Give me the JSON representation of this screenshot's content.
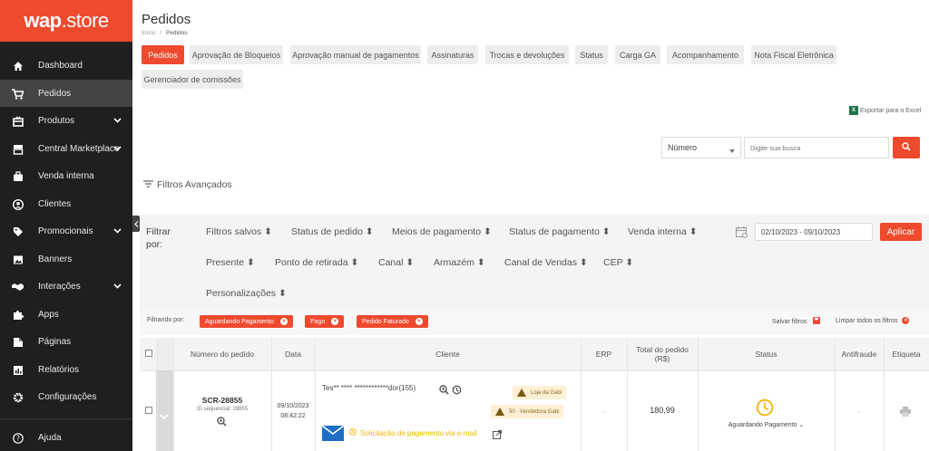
{
  "brand": {
    "name_bold": "wap",
    "name_rest": ".store"
  },
  "sidebar": {
    "items": [
      {
        "label": "Dashboard",
        "icon": "home-icon"
      },
      {
        "label": "Pedidos",
        "icon": "cart-icon"
      },
      {
        "label": "Produtos",
        "icon": "box-icon"
      },
      {
        "label": "Central Marketplace",
        "icon": "store-icon"
      },
      {
        "label": "Venda interna",
        "icon": "briefcase-icon"
      },
      {
        "label": "Clientes",
        "icon": "user-icon"
      },
      {
        "label": "Promocionais",
        "icon": "tag-icon"
      },
      {
        "label": "Banners",
        "icon": "image-icon"
      },
      {
        "label": "Interações",
        "icon": "handshake-icon"
      },
      {
        "label": "Apps",
        "icon": "puzzle-icon"
      },
      {
        "label": "Páginas",
        "icon": "file-icon"
      },
      {
        "label": "Relatórios",
        "icon": "chart-icon"
      },
      {
        "label": "Configurações",
        "icon": "gear-icon"
      }
    ],
    "help_label": "Ajuda"
  },
  "page": {
    "title": "Pedidos",
    "breadcrumb_home": "Início",
    "breadcrumb_sep": "/",
    "breadcrumb_current": "Pedidos"
  },
  "tabs": [
    "Pedidos",
    "Aprovação de Bloqueios",
    "Aprovação manual de pagamentos",
    "Assinaturas",
    "Trocas e devoluções",
    "Status",
    "Carga GA",
    "Acompanhamento",
    "Nota Fiscal Eletrônica",
    "Gerenciador de comissões"
  ],
  "export_label": "Exportar para o Excel",
  "search": {
    "type_value": "Número",
    "placeholder": "Digite sua busca"
  },
  "advanced_filters_label": "Filtros Avançados",
  "filters": {
    "filter_by": "Filtrar por:",
    "items": [
      "Filtros salvos",
      "Status de pedido",
      "Meios de pagamento",
      "Status de pagamento",
      "Venda interna",
      "Presente",
      "Ponto de retirada",
      "Canal",
      "Armazém",
      "Canal de Vendas",
      "CEP",
      "Personalizações"
    ],
    "date_range": "02/10/2023 - 09/10/2023",
    "apply_label": "Aplicar"
  },
  "active_filters": {
    "label": "Filtrando por:",
    "chips": [
      "Aguardando Pagamento",
      "Pago",
      "Pedido Faturado"
    ],
    "save_label": "Salvar filtros",
    "clear_label": "Limpar todos os filtros"
  },
  "table": {
    "headers": {
      "order": "Número do pedido",
      "date": "Data",
      "client": "Cliente",
      "erp": "ERP",
      "total": "Total do pedido (R$)",
      "status": "Status",
      "fraud": "Antifraude",
      "label": "Etiqueta"
    },
    "row": {
      "order_number": "SCR-28855",
      "seq_id": "ID sequencial: 28855",
      "date": "09/10/2023",
      "time": "08:42:22",
      "client_name": "Tes** **** ************dor(155)",
      "store_tag": "Loja da Gabi",
      "seller_tag": "50 - Vendedora Gabi",
      "payment_request": "Solicitação de pagamento via e-mail",
      "erp": "-",
      "total": "180,99",
      "status": "Aguardando Pagamento",
      "fraud": "-"
    }
  },
  "colors": {
    "accent": "#ee4a2e",
    "sidebar_bg": "#1f1f1f",
    "status_yellow": "#f0b400",
    "email_blue": "#1e6fc4"
  }
}
